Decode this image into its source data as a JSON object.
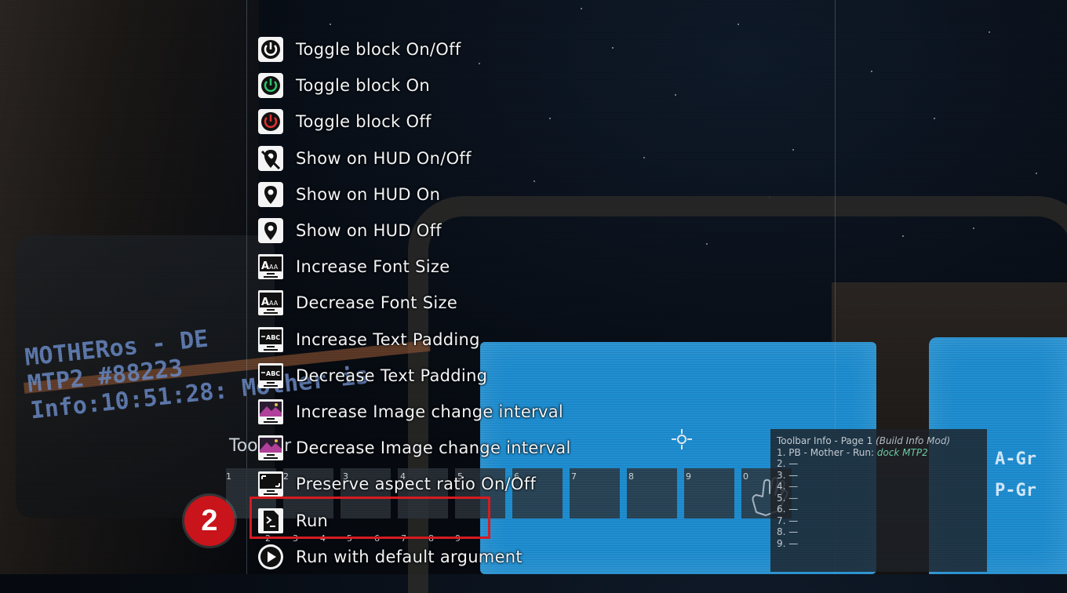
{
  "actions": [
    {
      "label": "Toggle block On/Off",
      "icon": "power-icon"
    },
    {
      "label": "Toggle block On",
      "icon": "power-on-icon"
    },
    {
      "label": "Toggle block Off",
      "icon": "power-off-icon"
    },
    {
      "label": "Show on HUD On/Off",
      "icon": "hud-toggle-icon"
    },
    {
      "label": "Show on HUD On",
      "icon": "hud-on-icon"
    },
    {
      "label": "Show on HUD Off",
      "icon": "hud-off-icon"
    },
    {
      "label": "Increase Font Size",
      "icon": "font-size-icon"
    },
    {
      "label": "Decrease Font Size",
      "icon": "font-size-icon"
    },
    {
      "label": "Increase Text Padding",
      "icon": "text-padding-icon"
    },
    {
      "label": "Decrease Text Padding",
      "icon": "text-padding-icon"
    },
    {
      "label": "Increase Image change interval",
      "icon": "image-interval-icon"
    },
    {
      "label": "Decrease Image change interval",
      "icon": "image-interval-icon"
    },
    {
      "label": "Preserve aspect ratio On/Off",
      "icon": "aspect-ratio-icon"
    },
    {
      "label": "Run",
      "icon": "terminal-run-icon"
    },
    {
      "label": "Run with default argument",
      "icon": "play-icon"
    }
  ],
  "step_badge": "2",
  "toolbar": {
    "label": "Toolbar",
    "slot_numbers": [
      "1",
      "2",
      "3",
      "4",
      "5",
      "6",
      "7",
      "8",
      "9",
      "0"
    ],
    "bottom_numbers": [
      "2",
      "3",
      "4",
      "5",
      "6",
      "7",
      "8",
      "9"
    ]
  },
  "toolbar_info": {
    "title_prefix": "Toolbar Info - Page 1",
    "title_mod": "(Build Info Mod)",
    "row1_prefix": "1. PB - Mother - Run:",
    "row1_arg": "dock MTP2",
    "rows": [
      "2. —",
      "3. —",
      "4. —",
      "5. —",
      "6. —",
      "7. —",
      "8. —",
      "9. —"
    ]
  },
  "lcd_left": {
    "line1": "MOTHERos - DE",
    "line2": "MTP2 #88223",
    "line3": "Info:10:51:28: Mother is"
  },
  "lcd_right": {
    "line1": "A-Gr",
    "line2": "P-Gr"
  },
  "colors": {
    "highlight": "#d61b20",
    "badge": "#c8141a",
    "lcd_blue": "#1f8fd2",
    "run_arg": "#6fd0a8"
  }
}
